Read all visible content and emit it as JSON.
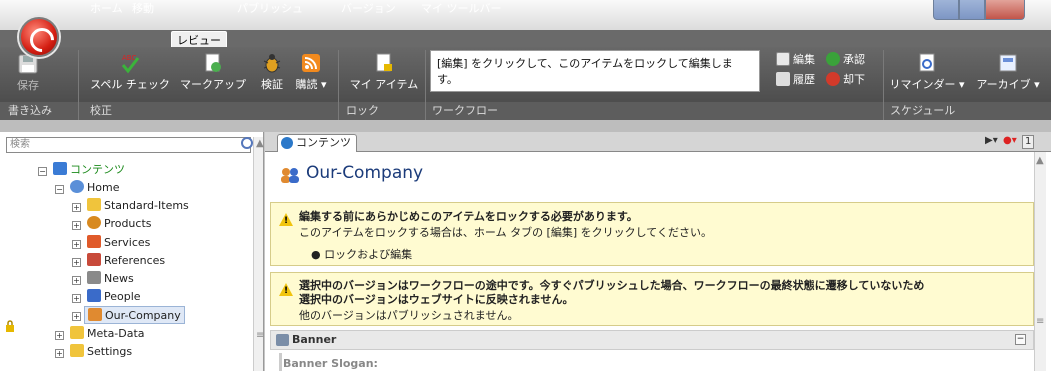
{
  "ribbon_tabs": [
    "ホーム",
    "移動",
    "レビュー",
    "パブリッシュ",
    "バージョン",
    "マイ ツールバー"
  ],
  "active_tab": "レビュー",
  "groups": {
    "write": {
      "label": "書き込み",
      "save": "保存"
    },
    "proofing": {
      "label": "校正",
      "spellcheck": "スペル チェック",
      "markup": "マークアップ",
      "validate": "検証",
      "subscribe": "購読 ▾"
    },
    "lock": {
      "label": "ロック",
      "my_items": "マイ アイテム"
    },
    "workflow": {
      "label": "ワークフロー",
      "message": "[編集] をクリックして、このアイテムをロックして編集します。",
      "edit": "編集",
      "approve": "承認",
      "history": "履歴",
      "reject": "却下"
    },
    "schedule": {
      "label": "スケジュール",
      "reminder": "リマインダー ▾",
      "archive": "アーカイブ ▾"
    }
  },
  "search": {
    "placeholder": "検索"
  },
  "tree": {
    "root": "コンテンツ",
    "home": "Home",
    "items": [
      "Standard-Items",
      "Products",
      "Services",
      "References",
      "News",
      "People",
      "Our-Company"
    ],
    "meta": "Meta-Data",
    "settings": "Settings"
  },
  "content_tab": "コンテンツ",
  "item_title": "Our-Company",
  "warning1": {
    "title": "編集する前にあらかじめこのアイテムをロックする必要があります。",
    "text": "このアイテムをロックする場合は、ホーム タブの [編集] をクリックしてください。",
    "bullet": "ロックおよび編集"
  },
  "warning2": {
    "title1": "選択中のバージョンはワークフローの途中です。今すぐパブリッシュした場合、ワークフローの最終状態に遷移していないため",
    "title2": "選択中のバージョンはウェブサイトに反映されません。",
    "text": "他のバージョンはパブリッシュされません。"
  },
  "section": {
    "title": "Banner",
    "field": "Banner Slogan:"
  },
  "version_number": "1",
  "colors": {
    "accent": "#1b3b7a",
    "warning_bg": "#fffbd1",
    "tree_root": "#1b8a1b"
  }
}
